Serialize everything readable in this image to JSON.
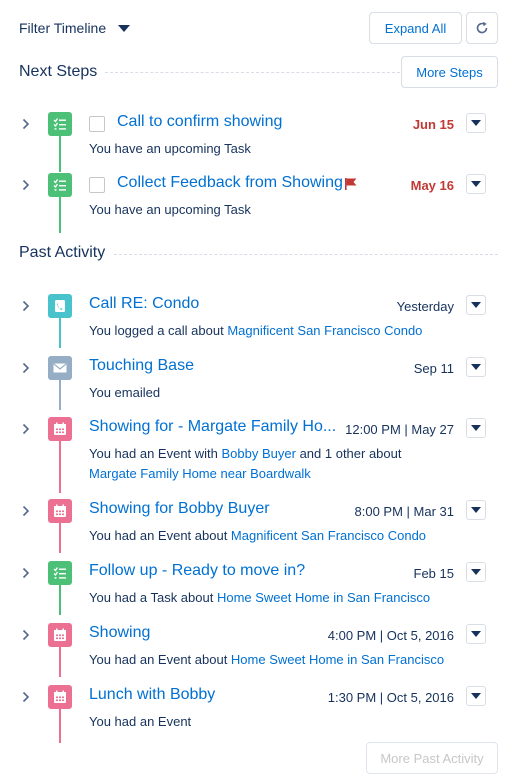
{
  "header": {
    "filter_label": "Filter Timeline",
    "expand_all_label": "Expand All"
  },
  "next_steps": {
    "title": "Next Steps",
    "more_label": "More Steps",
    "items": [
      {
        "title": "Call to confirm showing",
        "date": "Jun 15",
        "desc": "You have an upcoming Task",
        "icon": "task-icon"
      },
      {
        "title": "Collect Feedback from Showing",
        "date": "May 16",
        "desc": "You have an upcoming Task",
        "icon": "task-icon",
        "flag": "flag-icon"
      }
    ]
  },
  "past_activity": {
    "title": "Past Activity",
    "more_label": "More Past Activity",
    "items": [
      {
        "title": "Call RE: Condo",
        "date": "Yesterday",
        "desc_pre": "You logged a call about ",
        "link1": "Magnificent San Francisco Condo",
        "icon": "call-icon"
      },
      {
        "title": "Touching Base",
        "date": "Sep 11",
        "desc_pre": "You emailed",
        "icon": "email-icon"
      },
      {
        "title": "Showing for - Margate Family Ho...",
        "date": "12:00 PM | May 27",
        "desc_pre": "You had an Event with ",
        "link1": "Bobby Buyer",
        "desc_mid": " and 1 other about",
        "link2": "Margate Family Home near Boardwalk",
        "icon": "event-icon"
      },
      {
        "title": "Showing for Bobby Buyer",
        "date": "8:00 PM | Mar 31",
        "desc_pre": "You had an Event about ",
        "link1": "Magnificent San Francisco Condo",
        "icon": "event-icon"
      },
      {
        "title": "Follow up - Ready to move in?",
        "date": "Feb 15",
        "desc_pre": "You had a Task about ",
        "link1": "Home Sweet Home in San Francisco",
        "icon": "task-icon"
      },
      {
        "title": "Showing",
        "date": "4:00 PM | Oct 5, 2016",
        "desc_pre": "You had an Event about ",
        "link1": "Home Sweet Home in San Francisco",
        "icon": "event-icon"
      },
      {
        "title": "Lunch with Bobby",
        "date": "1:30 PM | Oct 5, 2016",
        "desc_pre": "You had an Event",
        "icon": "event-icon"
      }
    ]
  },
  "colors": {
    "task": "#4bc076",
    "call": "#48c3cc",
    "email": "#95aec5",
    "event": "#eb7092",
    "link": "#0070d2",
    "overdue": "#c23934",
    "text": "#16325c"
  }
}
